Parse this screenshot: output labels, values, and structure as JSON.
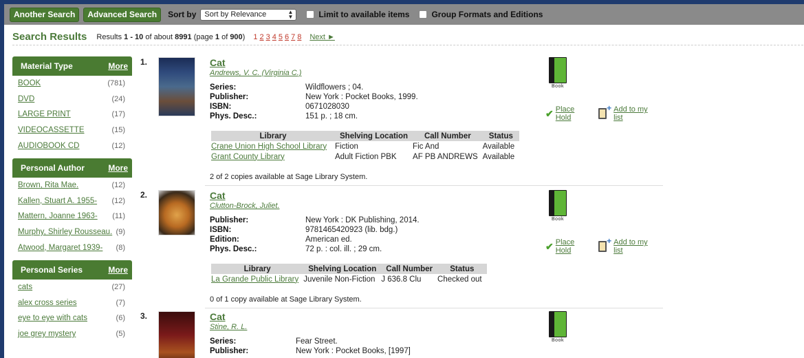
{
  "toolbar": {
    "another_search": "Another Search",
    "advanced_search": "Advanced Search",
    "sort_by_label": "Sort by",
    "sort_select": "Sort by Relevance",
    "limit_available": "Limit to available items",
    "group_formats": "Group Formats and Editions"
  },
  "results_header": {
    "title": "Search Results",
    "prefix": "Results ",
    "range": "1 - 10",
    "of_about": " of about ",
    "total": "8991",
    "page_open": " (page ",
    "page": "1",
    "of": " of ",
    "pages": "900",
    "page_close": ")",
    "page_links": [
      "1",
      "2",
      "3",
      "4",
      "5",
      "6",
      "7",
      "8"
    ],
    "next": "Next ►"
  },
  "sidebar": {
    "material_type": {
      "title": "Material Type",
      "more": "More",
      "items": [
        {
          "label": "BOOK",
          "count": "(781)"
        },
        {
          "label": "DVD",
          "count": "(24)"
        },
        {
          "label": "LARGE PRINT",
          "count": "(17)"
        },
        {
          "label": "VIDEOCASSETTE",
          "count": "(15)"
        },
        {
          "label": "AUDIOBOOK CD",
          "count": "(12)"
        }
      ]
    },
    "personal_author": {
      "title": "Personal Author",
      "more": "More",
      "items": [
        {
          "label": "Brown, Rita Mae.",
          "count": "(12)"
        },
        {
          "label": "Kallen, Stuart A. 1955-",
          "count": "(12)"
        },
        {
          "label": "Mattern, Joanne 1963-",
          "count": "(11)"
        },
        {
          "label": "Murphy, Shirley Rousseau.",
          "count": "(9)"
        },
        {
          "label": "Atwood, Margaret 1939-",
          "count": "(8)"
        }
      ]
    },
    "personal_series": {
      "title": "Personal Series",
      "more": "More",
      "items": [
        {
          "label": "cats",
          "count": "(27)"
        },
        {
          "label": "alex cross series",
          "count": "(7)"
        },
        {
          "label": "eye to eye with cats",
          "count": "(6)"
        },
        {
          "label": "joe grey mystery",
          "count": "(5)"
        }
      ]
    }
  },
  "results": [
    {
      "num": "1.",
      "title": "Cat",
      "author": "Andrews, V. C. (Virginia C.)",
      "meta": [
        {
          "k": "Series:",
          "v": "Wildflowers ; 04."
        },
        {
          "k": "Publisher:",
          "v": "New York : Pocket Books, 1999."
        },
        {
          "k": "ISBN:",
          "v": "0671028030"
        },
        {
          "k": "Phys. Desc.:",
          "v": "151 p. ; 18 cm."
        }
      ],
      "holdings_headers": [
        "Library",
        "Shelving Location",
        "Call Number",
        "Status"
      ],
      "holdings": [
        [
          "Crane Union High School Library",
          "Fiction",
          "Fic And",
          "Available"
        ],
        [
          "Grant County Library",
          "Adult Fiction PBK",
          "AF PB ANDREWS",
          "Available"
        ]
      ],
      "copies": "2 of 2 copies available at Sage Library System.",
      "format": "Book",
      "place_hold": "Place Hold",
      "add_list": "Add to my list"
    },
    {
      "num": "2.",
      "title": "Cat",
      "author": "Clutton-Brock, Juliet.",
      "meta": [
        {
          "k": "Publisher:",
          "v": "New York : DK Publishing, 2014."
        },
        {
          "k": "ISBN:",
          "v": "9781465420923 (lib. bdg.)"
        },
        {
          "k": "Edition:",
          "v": "American ed."
        },
        {
          "k": "Phys. Desc.:",
          "v": "72 p. : col. ill. ; 29 cm."
        }
      ],
      "holdings_headers": [
        "Library",
        "Shelving Location",
        "Call Number",
        "Status"
      ],
      "holdings": [
        [
          "La Grande Public Library",
          "Juvenile Non-Fiction",
          "J 636.8 Clu",
          "Checked out"
        ]
      ],
      "copies": "0 of 1 copy available at Sage Library System.",
      "format": "Book",
      "place_hold": "Place Hold",
      "add_list": "Add to my list"
    },
    {
      "num": "3.",
      "title": "Cat",
      "author": "Stine, R. L.",
      "meta": [
        {
          "k": "Series:",
          "v": "Fear Street."
        },
        {
          "k": "Publisher:",
          "v": "New York : Pocket Books, [1997]"
        }
      ],
      "format": "Book"
    }
  ],
  "colors": {
    "accent": "#4a7b32",
    "link": "#4b7a3a",
    "toolbar": "#8a8a8a",
    "page_link": "#c0392b"
  }
}
